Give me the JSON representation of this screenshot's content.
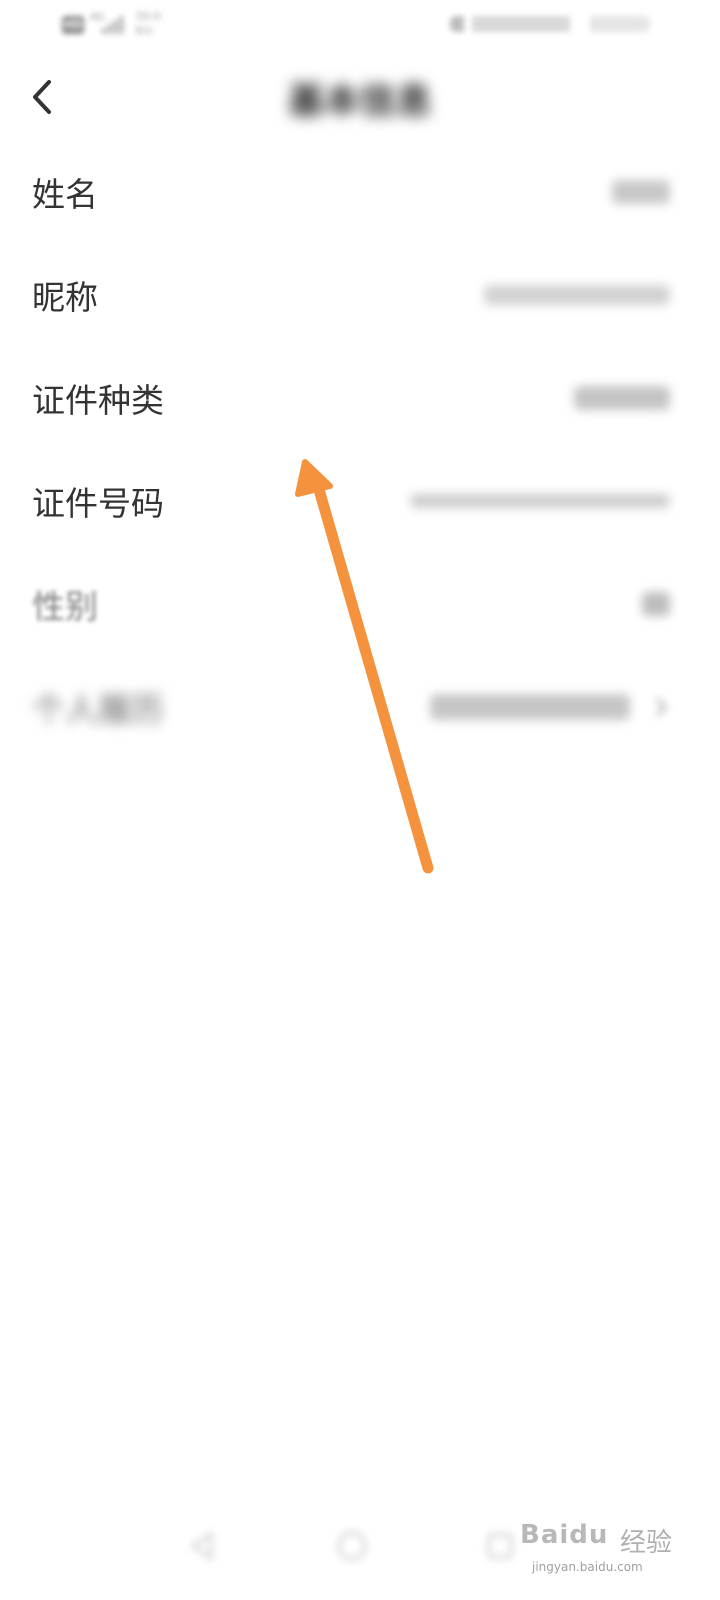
{
  "status_bar": {
    "hd_badge": "HD",
    "network": "4G",
    "speed_value": "50.0",
    "speed_unit": "K/s"
  },
  "header": {
    "title": "基本信息"
  },
  "rows": [
    {
      "label": "姓名",
      "value_w": 58,
      "value_h": 24
    },
    {
      "label": "昵称",
      "value_w": 186,
      "value_h": 20
    },
    {
      "label": "证件种类",
      "value_w": 96,
      "value_h": 24
    },
    {
      "label": "证件号码",
      "value_w": 260,
      "value_h": 14
    },
    {
      "label": "性别",
      "value_w": 28,
      "value_h": 24
    },
    {
      "label": "个人履历",
      "value_w": 200,
      "value_h": 26
    }
  ],
  "watermark": {
    "logo": "Bai",
    "logo_du": "du",
    "cn": "经验",
    "url": "jingyan.baidu.com"
  },
  "colors": {
    "arrow": "#f5923e",
    "text": "#333333"
  }
}
